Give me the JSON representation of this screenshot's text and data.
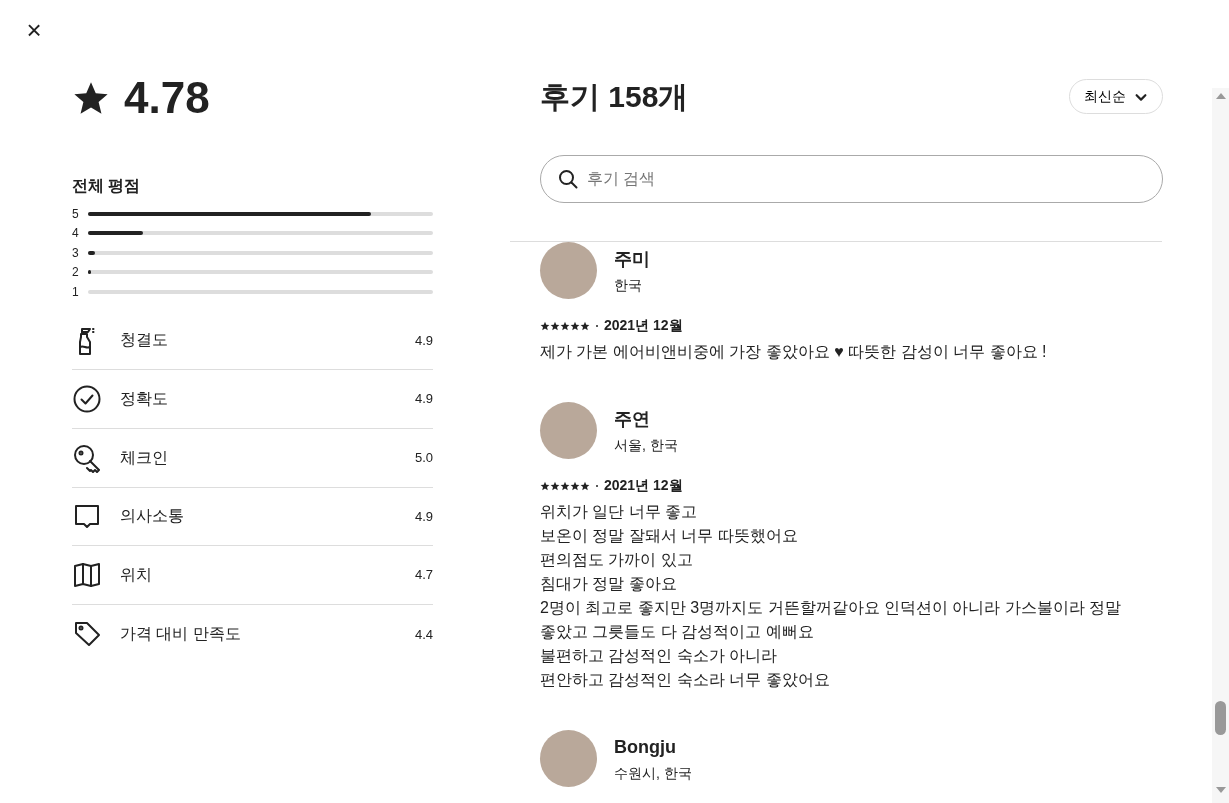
{
  "close_button": {
    "label": "×"
  },
  "overall": {
    "rating": "4.78",
    "heading": "전체 평점"
  },
  "distribution": [
    {
      "label": "5",
      "level": 0.82
    },
    {
      "label": "4",
      "level": 0.16
    },
    {
      "label": "3",
      "level": 0.02
    },
    {
      "label": "2",
      "level": 0.01
    },
    {
      "label": "1",
      "level": 0
    }
  ],
  "categories": [
    {
      "kind": "spray",
      "label": "청결도",
      "score": "4.9"
    },
    {
      "kind": "check",
      "label": "정확도",
      "score": "4.9"
    },
    {
      "kind": "key",
      "label": "체크인",
      "score": "5.0"
    },
    {
      "kind": "chat",
      "label": "의사소통",
      "score": "4.9"
    },
    {
      "kind": "map",
      "label": "위치",
      "score": "4.7"
    },
    {
      "kind": "tag",
      "label": "가격 대비 만족도",
      "score": "4.4"
    }
  ],
  "reviews_header": {
    "title": "후기 158개",
    "sort": "최신순"
  },
  "search": {
    "placeholder": "후기 검색"
  },
  "reviews": [
    {
      "name": "주미",
      "location": "한국",
      "stars": 5,
      "date": "2021년 12월",
      "text": "제가 가본 에어비앤비중에 가장 좋았아요 ♥ 따뜻한 감성이 너무 좋아요 !"
    },
    {
      "name": "주연",
      "location": "서울, 한국",
      "stars": 5,
      "date": "2021년 12월",
      "text": "위치가 일단 너무 좋고\n보온이 정말 잘돼서 너무 따뜻했어요\n편의점도 가까이 있고\n침대가 정말 좋아요\n2명이 최고로 좋지만 3명까지도 거뜬할꺼같아요 인덕션이 아니라 가스불이라 정말\n좋았고 그릇들도 다 감성적이고 예뻐요\n불편하고 감성적인 숙소가 아니라\n편안하고 감성적인 숙소라 너무 좋았어요"
    },
    {
      "name": "Bongju",
      "location": "수원시, 한국"
    }
  ]
}
